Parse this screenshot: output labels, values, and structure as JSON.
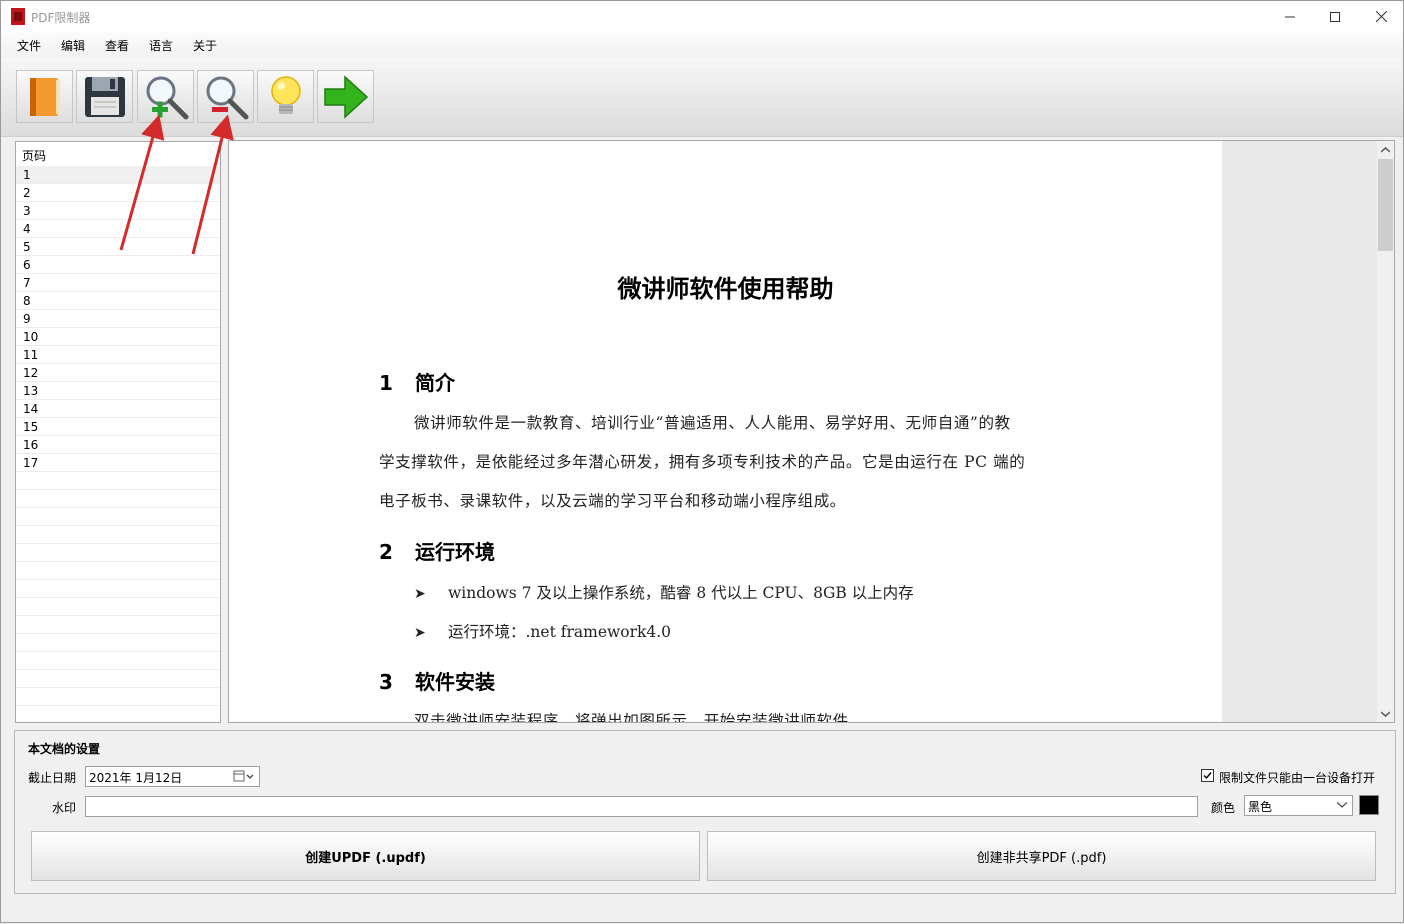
{
  "window": {
    "title": "PDF限制器"
  },
  "menu": [
    "文件",
    "编辑",
    "查看",
    "语言",
    "关于"
  ],
  "toolbar": {
    "buttons": [
      "open-book-icon",
      "save-floppy-icon",
      "zoom-in-icon",
      "zoom-out-icon",
      "lightbulb-icon",
      "green-arrow-right-icon"
    ]
  },
  "page_list": {
    "header": "页码",
    "pages": [
      "1",
      "2",
      "3",
      "4",
      "5",
      "6",
      "7",
      "8",
      "9",
      "10",
      "11",
      "12",
      "13",
      "14",
      "15",
      "16",
      "17"
    ]
  },
  "document": {
    "title": "微讲师软件使用帮助",
    "s1_num": "1",
    "s1_title": "简介",
    "s1_p1": "微讲师软件是一款教育、培训行业“普遍适用、人人能用、易学好用、无师自通”的教",
    "s1_p2": "学支撑软件，是依能经过多年潜心研发，拥有多项专利技术的产品。它是由运行在 PC 端的",
    "s1_p3": "电子板书、录课软件，以及云端的学习平台和移动端小程序组成。",
    "s2_num": "2",
    "s2_title": "运行环境",
    "s2_b1": "windows 7 及以上操作系统，酷睿 8 代以上 CPU、8GB 以上内存",
    "s2_b2": "运行环境：.net framework4.0",
    "s3_num": "3",
    "s3_title": "软件安装",
    "s3_p1": "双击微讲师安装程序，将弹出如图所示，开始安装微讲师软件。"
  },
  "settings": {
    "group_title": "本文档的设置",
    "expiry_label": "截止日期",
    "expiry_value": "2021年  1月12日",
    "restrict_label": "限制文件只能由一台设备打开",
    "restrict_checked": true,
    "watermark_label": "水印",
    "watermark_value": "",
    "color_label": "颜色",
    "color_value": "黑色",
    "color_swatch": "#000000",
    "create_updf": "创建UPDF (.updf)",
    "create_pdf": "创建非共享PDF (.pdf)"
  }
}
